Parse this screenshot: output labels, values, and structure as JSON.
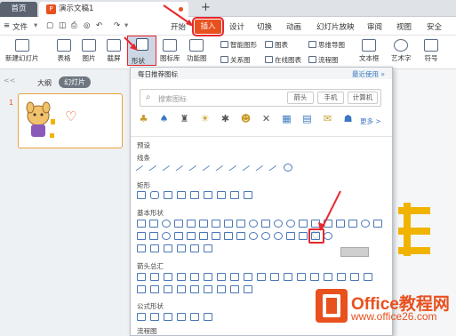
{
  "tabs": {
    "home": "首页",
    "document": "演示文稿1",
    "new": "+"
  },
  "menu": {
    "file": "文件",
    "items": [
      "开始",
      "插入",
      "设计",
      "切换",
      "动画",
      "幻灯片放映",
      "审阅",
      "视图",
      "安全"
    ]
  },
  "ribbon": {
    "new_slide": "新建幻灯片",
    "table": "表格",
    "picture": "图片",
    "screenshot": "截屏",
    "shape": "形状",
    "icon_lib": "图标库",
    "function_chart": "功能图",
    "smart_art": "智能图形",
    "chart": "图表",
    "mind_map": "思维导图",
    "relation": "关系图",
    "online_chart": "在线图表",
    "flowchart": "流程图",
    "textbox": "文本框",
    "wordart": "艺术字",
    "symbol": "符号"
  },
  "left_pane": {
    "tab_outline": "大纲",
    "tab_slides": "幻灯片",
    "slide_number": "1",
    "collapse": "<<"
  },
  "popup": {
    "header": "每日推荐图标",
    "more_link": "最近使用 »",
    "search_placeholder": "搜索图标",
    "filters": [
      "箭头",
      "手机",
      "计算机"
    ],
    "more": "更多 >",
    "preset": "预设",
    "sections": {
      "lines": "线条",
      "rectangles": "矩形",
      "basic": "基本形状",
      "block_arrows": "箭头总汇",
      "equation": "公式形状",
      "flowchart": "流程图"
    }
  },
  "watermark": {
    "name": "Office教程网",
    "url": "www.office26.com"
  }
}
